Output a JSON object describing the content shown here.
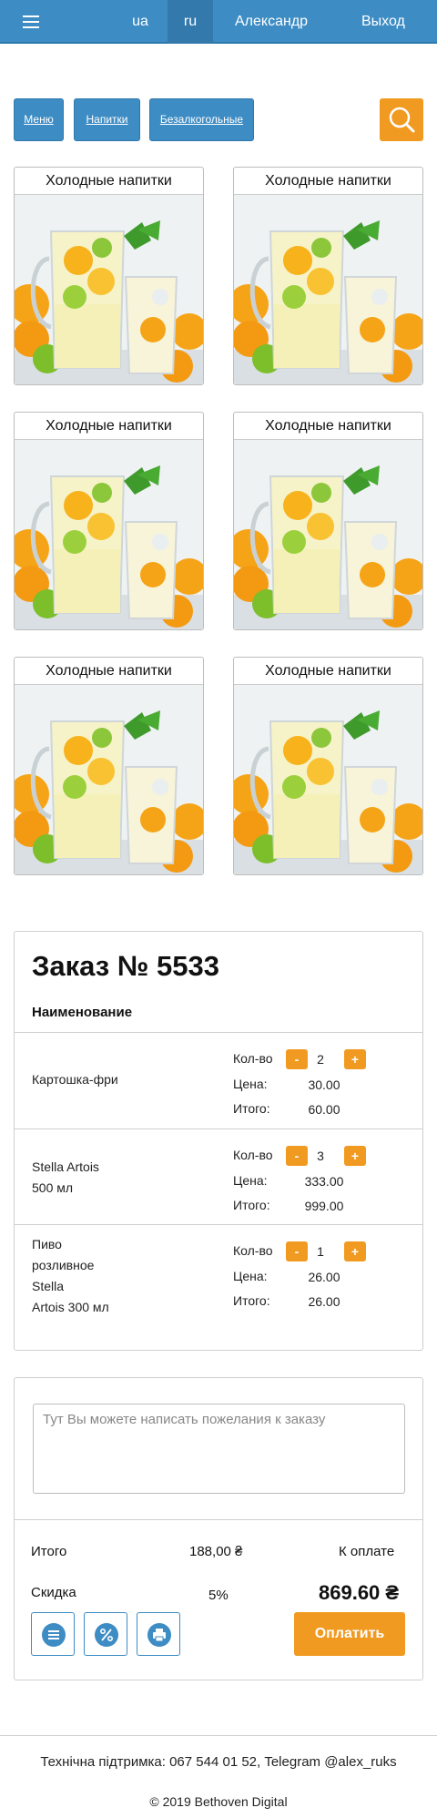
{
  "header": {
    "menu_icon": "hamburger-icon",
    "languages": [
      {
        "code": "ua",
        "active": false
      },
      {
        "code": "ru",
        "active": true
      }
    ],
    "user_name": "Александр",
    "logout_label": "Выход",
    "colors": {
      "bar": "#3d8cc4",
      "active_lang": "#3379ac"
    }
  },
  "breadcrumbs": [
    "Меню",
    "Напитки",
    "Безалкогольные"
  ],
  "search": {
    "icon": "search-icon",
    "color": "#f19a21"
  },
  "products": [
    {
      "title": "Холодные напитки",
      "image": "lemonade-photo"
    },
    {
      "title": "Холодные напитки",
      "image": "lemonade-photo"
    },
    {
      "title": "Холодные напитки",
      "image": "lemonade-photo"
    },
    {
      "title": "Холодные напитки",
      "image": "lemonade-photo"
    },
    {
      "title": "Холодные напитки",
      "image": "lemonade-photo"
    },
    {
      "title": "Холодные напитки",
      "image": "lemonade-photo"
    }
  ],
  "order": {
    "title": "Заказ № 5533",
    "column_header": "Наименование",
    "qty_label": "Кол-во",
    "price_label": "Цена:",
    "total_label": "Итого:",
    "minus": "-",
    "plus": "+",
    "items": [
      {
        "name_lines": [
          "Картошка-фри"
        ],
        "qty": "2",
        "price": "30.00",
        "total": "60.00"
      },
      {
        "name_lines": [
          "Stella Artois",
          "500 мл"
        ],
        "qty": "3",
        "price": "333.00",
        "total": "999.00"
      },
      {
        "name_lines": [
          "Пиво",
          "розливное",
          "Stella",
          "Artois 300 мл"
        ],
        "qty": "1",
        "price": "26.00",
        "total": "26.00"
      }
    ]
  },
  "payment": {
    "wishes_placeholder": "Тут Вы можете написать пожелания к заказу",
    "subtotal_label": "Итого",
    "subtotal_value": "188,00 ₴",
    "to_pay_label": "К оплате",
    "discount_label": "Скидка",
    "discount_value": "5%",
    "to_pay_value": "869.60 ₴",
    "pay_button": "Оплатить",
    "icons": [
      "list-icon",
      "percent-icon",
      "printer-icon"
    ],
    "accent": "#f19a21"
  },
  "footer": {
    "support": "Технічна підтримка: 067 544 01 52, Telegram @alex_ruks",
    "copyright": "© 2019 Bethoven Digital"
  }
}
